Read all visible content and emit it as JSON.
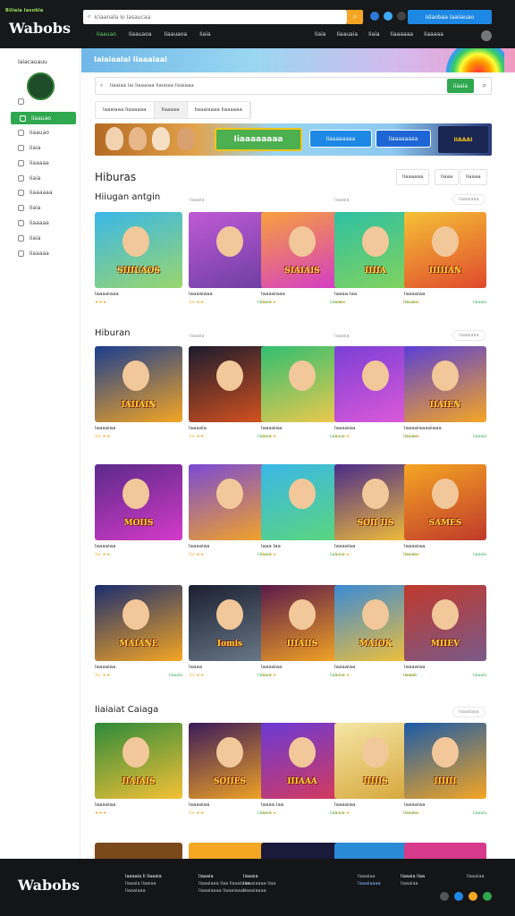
{
  "topbar": {
    "brand_small": "Biliaia Iasobla",
    "brand": "Wabobs",
    "search_placeholder": "Iciaanala Io Iasaucaa",
    "cta": "Islaobaa Iaaiiauao",
    "nav_left": [
      "Iiaauao",
      "Iiaauaoa",
      "Iiaauaoa",
      "Iiaia"
    ],
    "nav_right": [
      "Iiaia",
      "Iiaauaia",
      "Iiaia",
      "Iiaaaaaa",
      "Iiaaaaa"
    ]
  },
  "sidebar": {
    "title": "Iaiacauauu",
    "active": "Iiaauao",
    "items": [
      "Iiaauao",
      "Iiaia",
      "Iiaaaaa",
      "Iiaia",
      "Iiaaaaaa",
      "Iiaia",
      "Iiaaaaa",
      "Iiaia",
      "Iiaaaaa"
    ]
  },
  "hero": {
    "title": "Iaiaiaalai Iiaaaiaai"
  },
  "search": {
    "placeholder": "Iiaaiaa lai Iiaaaiaa Iiaiaiaa lisaiaaa",
    "button": "Iiaaia"
  },
  "filters": [
    "Iaaaiaaa Iiaaaaaa",
    "Iiaaaaa",
    "Iiaaaiaaaa Iiaaaaaa"
  ],
  "banner": {
    "cta1": "Iiaaaaaaaa",
    "cta2": "Iiaaaaaaaa",
    "cta3": "Iiaaaaaaaa",
    "logo": "IIAAAI"
  },
  "page": {
    "heading": "Hiburas",
    "sort": [
      "Iiaaaaaa",
      "Iiaaa",
      "Iiaaaa"
    ]
  },
  "sections": [
    {
      "title": "Hiiugan antgin",
      "meta1": "Iiaaaia",
      "meta2": "Iiaaaia",
      "pill": "Iiaaaiaaa",
      "cards": [
        {
          "name": "Iaaaaiaaa",
          "thumb": "SIIIUAOS",
          "rating": "★★★",
          "extra": "",
          "colors": [
            "#3ab7e8",
            "#9ad66d"
          ]
        },
        {
          "name": "Iaaaaiaaa",
          "thumb": "",
          "rating": "3a ★★",
          "extra": "Iiaaaia",
          "colors": [
            "#c05ad6",
            "#6b3ea3"
          ]
        },
        {
          "name": "Iaaaaiaaa",
          "thumb": "SIAIAIS",
          "rating": "3a ★★",
          "extra": "Iiaaaia",
          "colors": [
            "#f7a13c",
            "#d43ac9"
          ]
        },
        {
          "name": "Iaaaa Iaa",
          "thumb": "IIIIA",
          "rating": "★★★",
          "extra": "Iiaaaia",
          "colors": [
            "#2dc1a3",
            "#85d35a"
          ]
        },
        {
          "name": "Iaaaaiaa",
          "thumb": "IIIIIAN",
          "rating": "3a ★★",
          "extra": "Iiaaaia",
          "colors": [
            "#f5c136",
            "#e04a2d"
          ]
        }
      ]
    },
    {
      "title": "Hiburan",
      "meta1": "Iiaaaia",
      "meta2": "Iiaaaia",
      "pill": "Iiaaaiaaa",
      "cards": [
        {
          "name": "Iaaaaiaa",
          "thumb": "IAIIAIN",
          "rating": "3a ★★",
          "extra": "",
          "colors": [
            "#1a3d8f",
            "#f5a623"
          ]
        },
        {
          "name": "Iaaaaia",
          "thumb": "",
          "rating": "3a ★★",
          "extra": "Iiaaaia",
          "colors": [
            "#1b1b2e",
            "#d9531e"
          ]
        },
        {
          "name": "Iaaaaiaa",
          "thumb": "",
          "rating": "3a ★★",
          "extra": "Iiaaaia",
          "colors": [
            "#2fbf71",
            "#f2c94c"
          ]
        },
        {
          "name": "Iaaaaiaa",
          "thumb": "",
          "rating": "3a ★★",
          "extra": "Iiaaaia",
          "colors": [
            "#7b3fd6",
            "#e05ad9"
          ]
        },
        {
          "name": "Iaaaaiaaaaiaaa",
          "thumb": "IIAIEN",
          "rating": "3a ★★",
          "extra": "Iiaaaia",
          "colors": [
            "#5a3fd6",
            "#f5a623"
          ]
        }
      ]
    },
    {
      "title": "",
      "meta1": "",
      "meta2": "",
      "pill": "",
      "cards": [
        {
          "name": "Iaaaaiaa",
          "thumb": "MOIIS",
          "rating": "3a ★★",
          "extra": "",
          "colors": [
            "#5b2a8a",
            "#d43ac9"
          ]
        },
        {
          "name": "Iaaaaiaa",
          "thumb": "",
          "rating": "3a ★★",
          "extra": "Iiaaaia",
          "colors": [
            "#7a4ad6",
            "#f5a623"
          ]
        },
        {
          "name": "Iaaa Iaa",
          "thumb": "",
          "rating": "3a ★★",
          "extra": "Iiaaaia",
          "colors": [
            "#3ab7e8",
            "#5bd67a"
          ]
        },
        {
          "name": "Iaaaaiaa",
          "thumb": "SOII IIS",
          "rating": "3a ★★",
          "extra": "Iiaaaia",
          "colors": [
            "#4a2a8a",
            "#f5c136"
          ]
        },
        {
          "name": "Iaaaaiaa",
          "thumb": "SAMES",
          "rating": "3a ★★",
          "extra": "Iiaaaia",
          "colors": [
            "#f5a623",
            "#c0392b"
          ]
        }
      ]
    },
    {
      "title": "",
      "meta1": "",
      "meta2": "",
      "pill": "",
      "cards": [
        {
          "name": "Iaaaaiaa",
          "thumb": "MAIANE",
          "rating": "3a ★★",
          "extra": "Iiaaaia",
          "colors": [
            "#1a2d6f",
            "#f5a623"
          ]
        },
        {
          "name": "Iaaaa",
          "thumb": "Iomis",
          "rating": "3a ★★",
          "extra": "Iiaaaia",
          "colors": [
            "#1a1f2e",
            "#6a7a8a"
          ]
        },
        {
          "name": "Iaaaaiaa",
          "thumb": "IIIAIIS",
          "rating": "3a ★★",
          "extra": "Iiaaaia",
          "colors": [
            "#5a1a4a",
            "#f5a623"
          ]
        },
        {
          "name": "Iaaaaiaa",
          "thumb": "MAIOK",
          "rating": "3a ★★",
          "extra": "Iiaaaia",
          "colors": [
            "#3a8ad6",
            "#f5c136"
          ]
        },
        {
          "name": "Iaaaaiaa",
          "thumb": "MIIEV",
          "rating": "★★★",
          "extra": "Iiaaaia",
          "colors": [
            "#c0392b",
            "#7a5a8a"
          ]
        }
      ]
    },
    {
      "title": "Iiaiaiat Caiaga",
      "meta1": "",
      "meta2": "",
      "pill": "Iiaaaiaaa",
      "cards": [
        {
          "name": "Iaaaaiaa",
          "thumb": "IIAIAIS",
          "rating": "★★★",
          "extra": "",
          "colors": [
            "#2d8a3a",
            "#f5c136"
          ]
        },
        {
          "name": "Iaaaaiaa",
          "thumb": "SOIIES",
          "rating": "3a ★★",
          "extra": "Iiaaaia",
          "colors": [
            "#3a1a5a",
            "#f5a623"
          ]
        },
        {
          "name": "Iaaaa Iaa",
          "thumb": "IIIAAA",
          "rating": "3a ★★",
          "extra": "Iiaaaia",
          "colors": [
            "#6a3ad6",
            "#d63a5a"
          ]
        },
        {
          "name": "Iaaaaiaa",
          "thumb": "IIIIIS",
          "rating": "3a ★★",
          "extra": "Iiaaaia",
          "colors": [
            "#f5e6a6",
            "#d6a63a"
          ]
        },
        {
          "name": "Iaaaaiaa",
          "thumb": "IIIIII",
          "rating": "3a ★★",
          "extra": "Iiaaaia",
          "colors": [
            "#1a5aa8",
            "#f5a623"
          ]
        }
      ]
    }
  ],
  "footer": {
    "brand": "Wabobs",
    "col1_title": "Iaaaaia Ii Iiaaaia",
    "col1": [
      "Iiaaaia Iiaaiaa",
      "Iiaaaiaaa"
    ],
    "col2_title": "Iiaaaia",
    "col2": [
      "Iiaaaiaaa Iiaa Iiaaaiaaa",
      "Iiaaaiaaaa Iiaaaiaaaa"
    ],
    "col3_title": "Iiaaaia",
    "col3": [
      "Iiaaaiaaaa Iiaa",
      "Iiaaaiaaaa"
    ],
    "col4": [
      "Iiaaaiaa",
      "Iiaaaiaaaa"
    ],
    "col5_title": "Iiaaaia Iiaa",
    "col5": [
      "Iiaaaiaa"
    ],
    "col6": [
      "Iiaaaiaa"
    ]
  }
}
